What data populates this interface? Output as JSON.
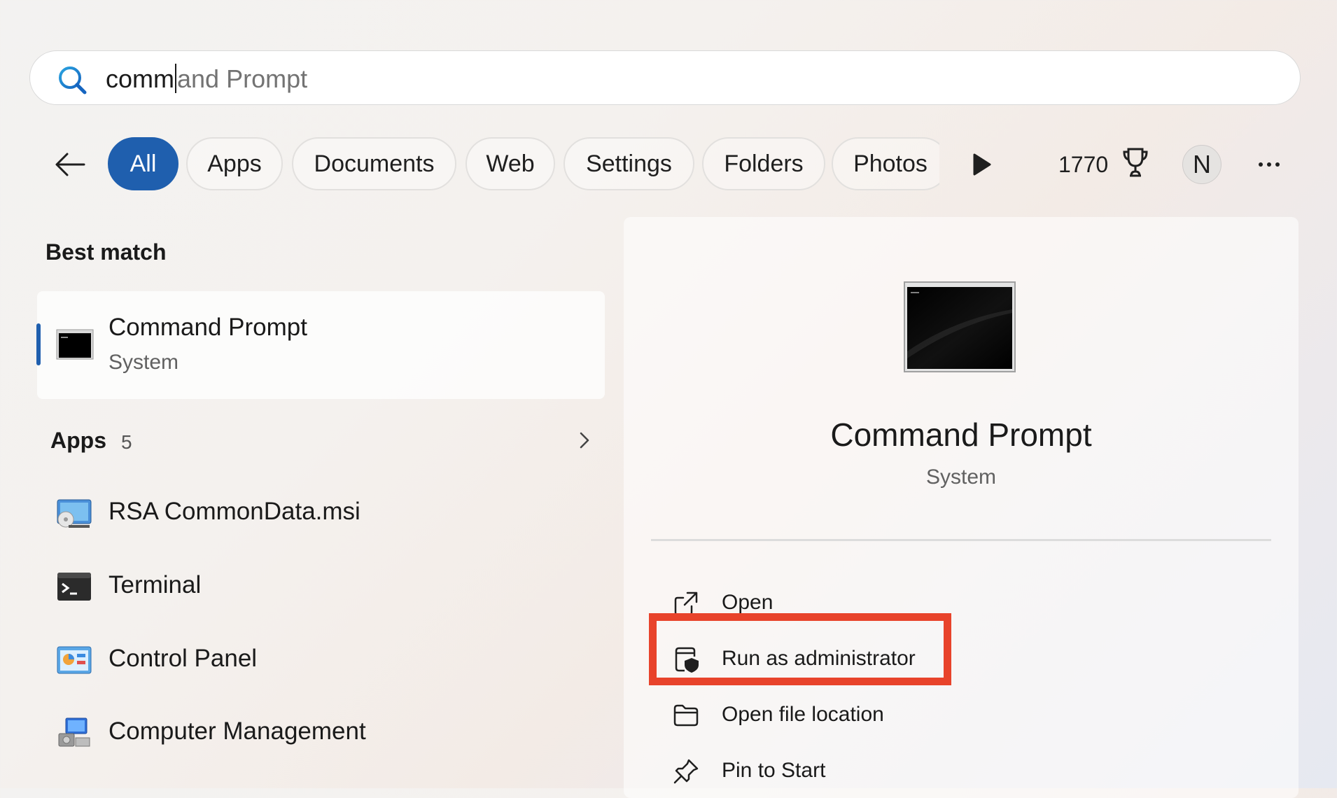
{
  "search": {
    "typed": "comm",
    "suggestion": "and Prompt"
  },
  "filters": {
    "chips": [
      "All",
      "Apps",
      "Documents",
      "Web",
      "Settings",
      "Folders",
      "Photos"
    ],
    "active": "All",
    "points": "1770",
    "avatar_initial": "N"
  },
  "best_match": {
    "heading": "Best match",
    "title": "Command Prompt",
    "subtitle": "System"
  },
  "apps": {
    "heading": "Apps",
    "count": "5",
    "items": [
      {
        "label": "RSA CommonData.msi",
        "icon": "installer-icon"
      },
      {
        "label": "Terminal",
        "icon": "terminal-icon"
      },
      {
        "label": "Control Panel",
        "icon": "control-panel-icon"
      },
      {
        "label": "Computer Management",
        "icon": "computer-management-icon"
      }
    ]
  },
  "detail": {
    "title": "Command Prompt",
    "subtitle": "System",
    "actions": [
      {
        "label": "Open",
        "icon": "open-external-icon"
      },
      {
        "label": "Run as administrator",
        "icon": "shield-admin-icon"
      },
      {
        "label": "Open file location",
        "icon": "folder-icon"
      },
      {
        "label": "Pin to Start",
        "icon": "pin-icon"
      }
    ]
  },
  "colors": {
    "accent": "#1f5fae",
    "highlight": "#e8432b"
  }
}
